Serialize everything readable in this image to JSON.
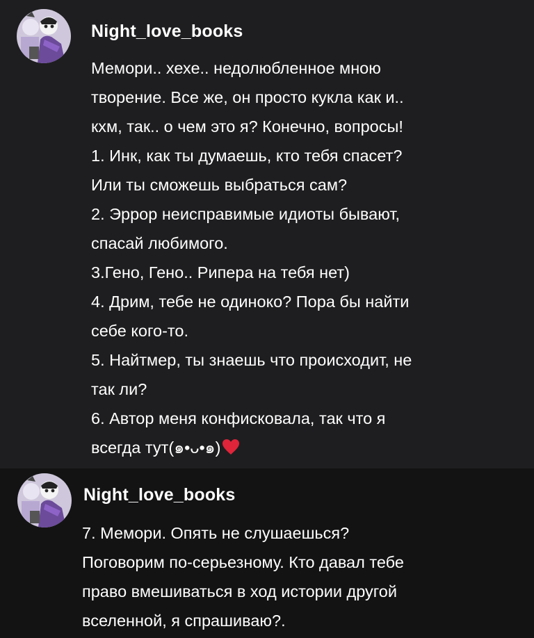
{
  "comments": [
    {
      "username": "Night_love_books",
      "avatar_icon": "anime-character-avatar-icon",
      "lines": [
        "Мемори.. хехе.. недолюбленное мною",
        "творение. Все же, он просто кукла как и..",
        "кхм, так.. о чем это я? Конечно, вопросы!",
        "1. Инк, как ты думаешь, кто тебя спасет?",
        "Или ты сможешь выбраться сам?",
        "2. Эррор неисправимые идиоты бывают,",
        "спасай любимого.",
        "3.Гено, Гено.. Рипера на тебя нет)",
        "4. Дрим, тебе не одиноко? Пора бы найти",
        "себе кого-то.",
        "5. Найтмер, ты знаешь что происходит, не",
        "так ли?",
        "6. Автор меня конфисковала, так что я",
        "всегда тут(๑•ᴗ•๑)"
      ],
      "emoji": "heart-emoji-icon"
    },
    {
      "username": "Night_love_books",
      "avatar_icon": "anime-character-avatar-icon",
      "lines": [
        "7. Мемори. Опять не слушаешься?",
        "Поговорим по-серьезному. Кто давал тебе",
        "право вмешиваться в ход истории другой",
        "вселенной, я спрашиваю?."
      ]
    }
  ],
  "colors": {
    "bg_first": "#1e1e20",
    "bg_second": "#131314",
    "text": "#ffffff",
    "heart": "#e0243a"
  }
}
